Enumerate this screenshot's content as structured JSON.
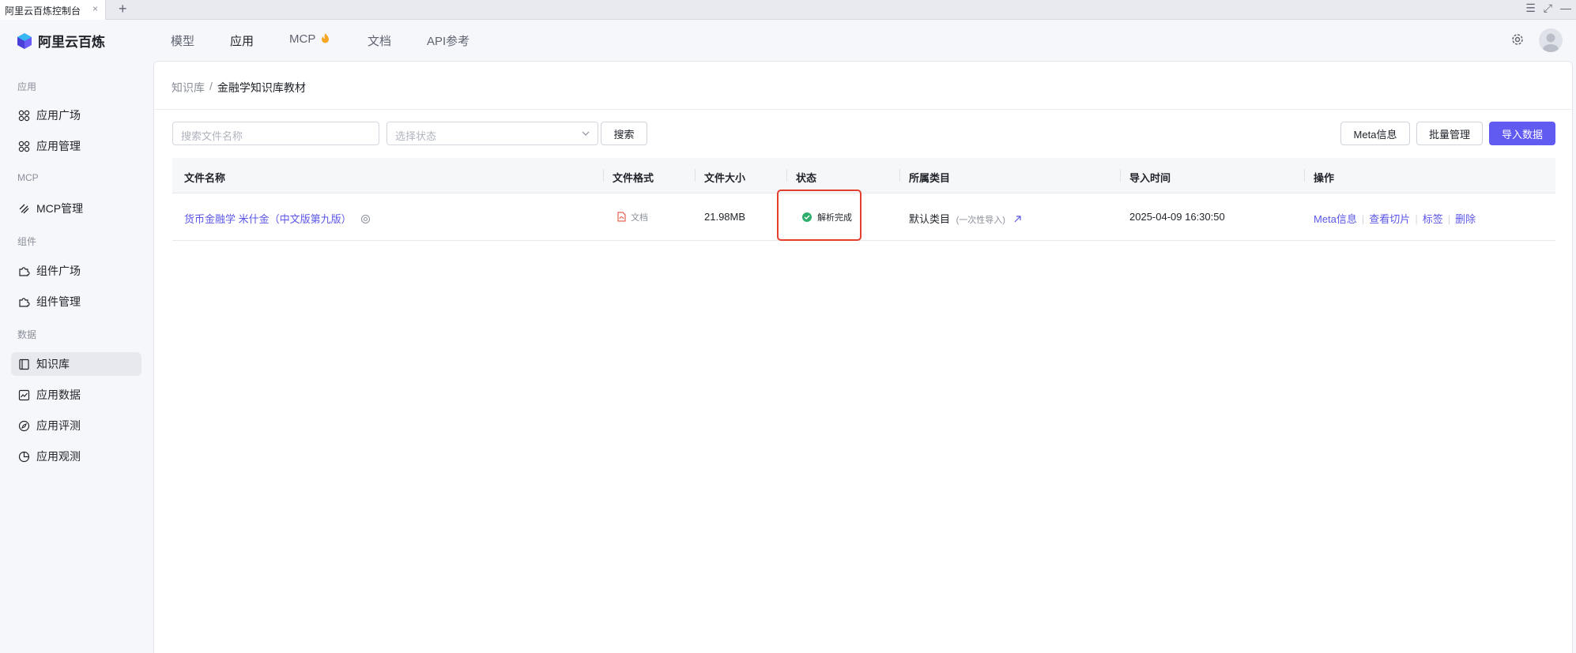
{
  "browser": {
    "tab_title": "阿里云百炼控制台",
    "tab_close": "×",
    "tab_add": "+"
  },
  "topnav": {
    "logo_text": "阿里云百炼",
    "items": [
      {
        "label": "模型",
        "active": false
      },
      {
        "label": "应用",
        "active": true
      },
      {
        "label": "MCP",
        "active": false
      },
      {
        "label": "文档",
        "active": false
      },
      {
        "label": "API参考",
        "active": false
      }
    ],
    "mcp_icon": "flame-icon"
  },
  "sidebar": {
    "groups": [
      {
        "label": "应用",
        "items": [
          {
            "label": "应用广场",
            "icon": "grid-icon"
          },
          {
            "label": "应用管理",
            "icon": "grid-icon"
          }
        ]
      },
      {
        "label": "MCP",
        "items": [
          {
            "label": "MCP管理",
            "icon": "mcp-icon"
          }
        ]
      },
      {
        "label": "组件",
        "items": [
          {
            "label": "组件广场",
            "icon": "puzzle-icon"
          },
          {
            "label": "组件管理",
            "icon": "puzzle-icon"
          }
        ]
      },
      {
        "label": "数据",
        "items": [
          {
            "label": "知识库",
            "icon": "book-icon",
            "active": true
          },
          {
            "label": "应用数据",
            "icon": "chart-icon"
          },
          {
            "label": "应用评测",
            "icon": "compass-icon"
          },
          {
            "label": "应用观测",
            "icon": "pie-icon"
          }
        ]
      }
    ]
  },
  "main": {
    "breadcrumb": {
      "parent": "知识库",
      "separator": "/",
      "current": "金融学知识库教材"
    },
    "search": {
      "placeholder": "搜索文件名称",
      "button": "搜索"
    },
    "status_select": {
      "placeholder": "选择状态"
    },
    "actions": {
      "meta": "Meta信息",
      "batch": "批量管理",
      "import": "导入数据"
    },
    "table": {
      "columns": [
        "文件名称",
        "文件格式",
        "文件大小",
        "状态",
        "所属类目",
        "导入时间",
        "操作"
      ],
      "rows": [
        {
          "name": "货币金融学 米什金（中文版第九版）",
          "format": "文档",
          "size": "21.98MB",
          "status": "解析完成",
          "category": "默认类目",
          "category_note": "(一次性导入)",
          "time": "2025-04-09 16:30:50",
          "ops": [
            "Meta信息",
            "查看切片",
            "标签",
            "删除"
          ]
        }
      ]
    }
  },
  "colors": {
    "primary": "#625bf2",
    "link": "#5b56e8",
    "success": "#2fae6e",
    "highlight": "#e2402c"
  }
}
